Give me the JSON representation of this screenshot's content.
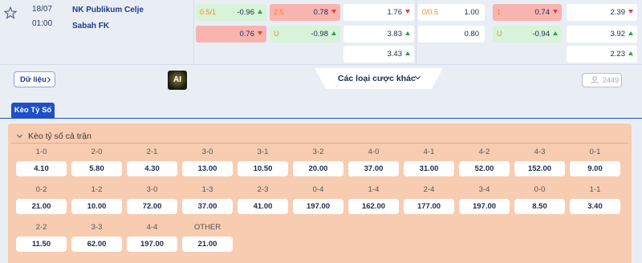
{
  "match": {
    "date": "18/07",
    "time": "01:00",
    "home": "NK Publikum Celje",
    "away": "Sabah FK"
  },
  "odds": {
    "ah_line1": "0.5/1",
    "ah_val1": "-0.96",
    "ah_val2": "0.76",
    "ou_line1": "2.5",
    "ou_val1": "0.78",
    "ou_line2": "U",
    "ou_val2": "-0.98",
    "x12_1": "1.76",
    "x12_2": "3.83",
    "x12_3": "3.43",
    "h1_ah_line": "0/0.5",
    "h1_ah_val1": "1.00",
    "h1_ah_val2": "0.80",
    "h1_ou_line1": "1",
    "h1_ou_val1": "0.74",
    "h1_ou_line2": "U",
    "h1_ou_val2": "-0.94",
    "h1_x12_1": "2.39",
    "h1_x12_2": "3.92",
    "h1_x12_3": "2.23"
  },
  "actions": {
    "data_button": "Dữ liệu",
    "ai_badge": "AI",
    "bet_types": "Các loại cược khác",
    "count": "2449"
  },
  "tabs": {
    "correct_score": "Kèo Tỷ Số"
  },
  "correct_score": {
    "heading": "Kèo tỷ số cả trận",
    "items": [
      {
        "score": "1-0",
        "odd": "4.10"
      },
      {
        "score": "2-0",
        "odd": "5.80"
      },
      {
        "score": "2-1",
        "odd": "4.30"
      },
      {
        "score": "3-0",
        "odd": "13.00"
      },
      {
        "score": "3-1",
        "odd": "10.50"
      },
      {
        "score": "3-2",
        "odd": "20.00"
      },
      {
        "score": "4-0",
        "odd": "37.00"
      },
      {
        "score": "4-1",
        "odd": "31.00"
      },
      {
        "score": "4-2",
        "odd": "52.00"
      },
      {
        "score": "4-3",
        "odd": "152.00"
      },
      {
        "score": "0-1",
        "odd": "9.00"
      },
      {
        "score": "0-2",
        "odd": "21.00"
      },
      {
        "score": "1-2",
        "odd": "10.00"
      },
      {
        "score": "3-0",
        "odd": "72.00"
      },
      {
        "score": "1-3",
        "odd": "37.00"
      },
      {
        "score": "2-3",
        "odd": "41.00"
      },
      {
        "score": "0-4",
        "odd": "197.00"
      },
      {
        "score": "1-4",
        "odd": "162.00"
      },
      {
        "score": "2-4",
        "odd": "177.00"
      },
      {
        "score": "3-4",
        "odd": "197.00"
      },
      {
        "score": "0-0",
        "odd": "8.50"
      },
      {
        "score": "1-1",
        "odd": "3.40"
      },
      {
        "score": "2-2",
        "odd": "11.50"
      },
      {
        "score": "3-3",
        "odd": "62.00"
      },
      {
        "score": "4-4",
        "odd": "197.00"
      },
      {
        "score": "OTHER",
        "odd": "21.00"
      }
    ]
  }
}
